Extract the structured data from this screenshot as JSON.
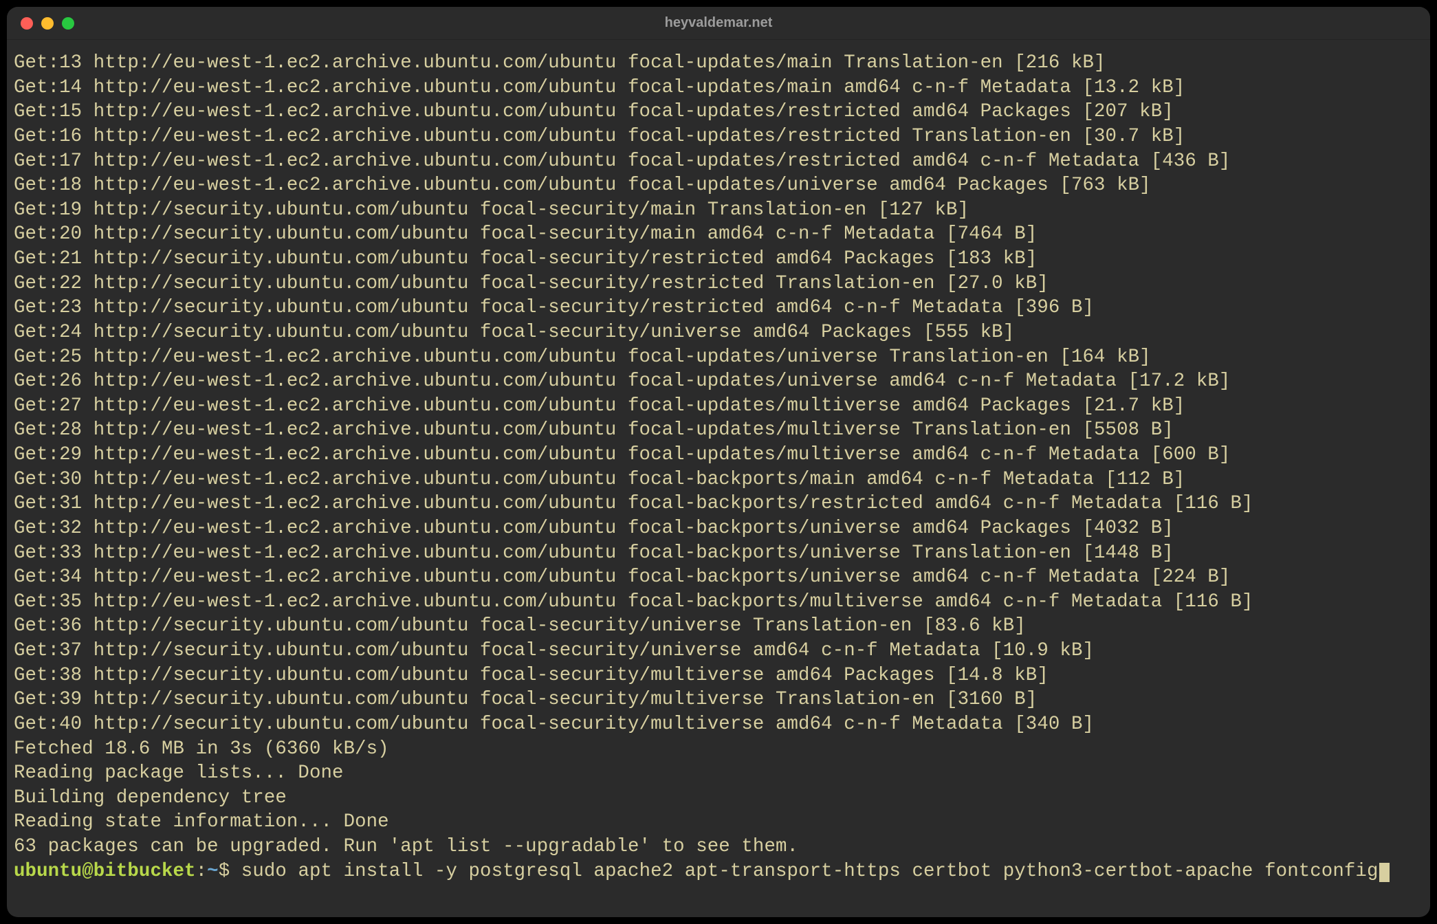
{
  "window": {
    "title": "heyvaldemar.net"
  },
  "terminal": {
    "lines": [
      "Get:13 http://eu-west-1.ec2.archive.ubuntu.com/ubuntu focal-updates/main Translation-en [216 kB]",
      "Get:14 http://eu-west-1.ec2.archive.ubuntu.com/ubuntu focal-updates/main amd64 c-n-f Metadata [13.2 kB]",
      "Get:15 http://eu-west-1.ec2.archive.ubuntu.com/ubuntu focal-updates/restricted amd64 Packages [207 kB]",
      "Get:16 http://eu-west-1.ec2.archive.ubuntu.com/ubuntu focal-updates/restricted Translation-en [30.7 kB]",
      "Get:17 http://eu-west-1.ec2.archive.ubuntu.com/ubuntu focal-updates/restricted amd64 c-n-f Metadata [436 B]",
      "Get:18 http://eu-west-1.ec2.archive.ubuntu.com/ubuntu focal-updates/universe amd64 Packages [763 kB]",
      "Get:19 http://security.ubuntu.com/ubuntu focal-security/main Translation-en [127 kB]",
      "Get:20 http://security.ubuntu.com/ubuntu focal-security/main amd64 c-n-f Metadata [7464 B]",
      "Get:21 http://security.ubuntu.com/ubuntu focal-security/restricted amd64 Packages [183 kB]",
      "Get:22 http://security.ubuntu.com/ubuntu focal-security/restricted Translation-en [27.0 kB]",
      "Get:23 http://security.ubuntu.com/ubuntu focal-security/restricted amd64 c-n-f Metadata [396 B]",
      "Get:24 http://security.ubuntu.com/ubuntu focal-security/universe amd64 Packages [555 kB]",
      "Get:25 http://eu-west-1.ec2.archive.ubuntu.com/ubuntu focal-updates/universe Translation-en [164 kB]",
      "Get:26 http://eu-west-1.ec2.archive.ubuntu.com/ubuntu focal-updates/universe amd64 c-n-f Metadata [17.2 kB]",
      "Get:27 http://eu-west-1.ec2.archive.ubuntu.com/ubuntu focal-updates/multiverse amd64 Packages [21.7 kB]",
      "Get:28 http://eu-west-1.ec2.archive.ubuntu.com/ubuntu focal-updates/multiverse Translation-en [5508 B]",
      "Get:29 http://eu-west-1.ec2.archive.ubuntu.com/ubuntu focal-updates/multiverse amd64 c-n-f Metadata [600 B]",
      "Get:30 http://eu-west-1.ec2.archive.ubuntu.com/ubuntu focal-backports/main amd64 c-n-f Metadata [112 B]",
      "Get:31 http://eu-west-1.ec2.archive.ubuntu.com/ubuntu focal-backports/restricted amd64 c-n-f Metadata [116 B]",
      "Get:32 http://eu-west-1.ec2.archive.ubuntu.com/ubuntu focal-backports/universe amd64 Packages [4032 B]",
      "Get:33 http://eu-west-1.ec2.archive.ubuntu.com/ubuntu focal-backports/universe Translation-en [1448 B]",
      "Get:34 http://eu-west-1.ec2.archive.ubuntu.com/ubuntu focal-backports/universe amd64 c-n-f Metadata [224 B]",
      "Get:35 http://eu-west-1.ec2.archive.ubuntu.com/ubuntu focal-backports/multiverse amd64 c-n-f Metadata [116 B]",
      "Get:36 http://security.ubuntu.com/ubuntu focal-security/universe Translation-en [83.6 kB]",
      "Get:37 http://security.ubuntu.com/ubuntu focal-security/universe amd64 c-n-f Metadata [10.9 kB]",
      "Get:38 http://security.ubuntu.com/ubuntu focal-security/multiverse amd64 Packages [14.8 kB]",
      "Get:39 http://security.ubuntu.com/ubuntu focal-security/multiverse Translation-en [3160 B]",
      "Get:40 http://security.ubuntu.com/ubuntu focal-security/multiverse amd64 c-n-f Metadata [340 B]",
      "Fetched 18.6 MB in 3s (6360 kB/s)",
      "Reading package lists... Done",
      "Building dependency tree",
      "Reading state information... Done",
      "63 packages can be upgraded. Run 'apt list --upgradable' to see them."
    ],
    "prompt": {
      "user_host": "ubuntu@bitbucket",
      "colon": ":",
      "path": "~",
      "symbol": "$",
      "command": "sudo apt install -y postgresql apache2 apt-transport-https certbot python3-certbot-apache fontconfig"
    }
  }
}
